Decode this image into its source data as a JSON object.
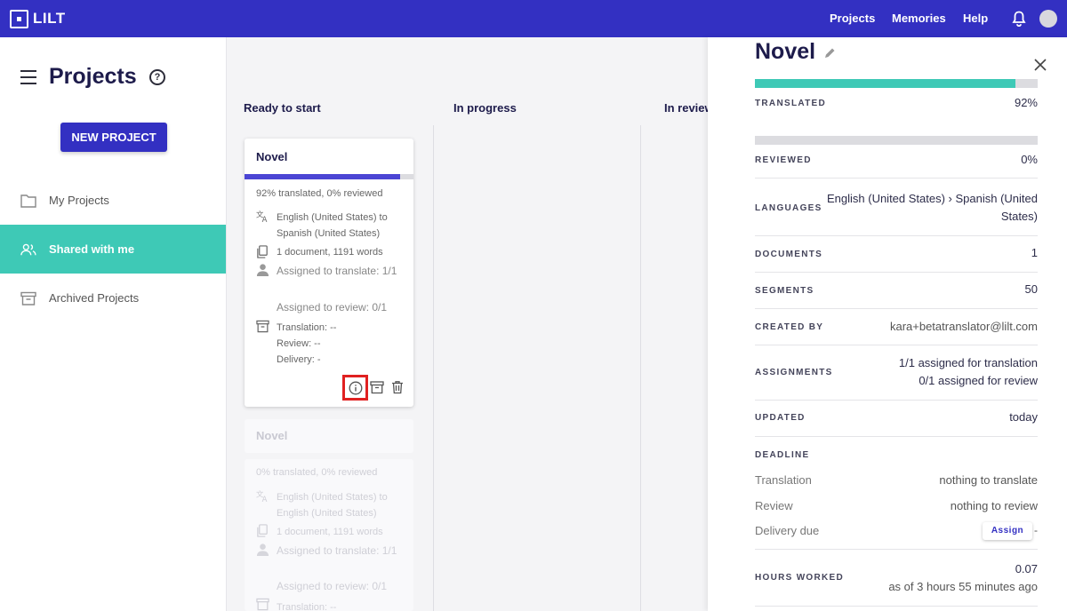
{
  "header": {
    "logo_text": "LILT",
    "nav": [
      "Projects",
      "Memories",
      "Help"
    ]
  },
  "sidebar": {
    "title": "Projects",
    "new_project_label": "NEW PROJECT",
    "items": [
      {
        "label": "My Projects",
        "icon": "folder-icon",
        "active": false
      },
      {
        "label": "Shared with me",
        "icon": "users-icon",
        "active": true
      },
      {
        "label": "Archived Projects",
        "icon": "archive-icon",
        "active": false
      }
    ]
  },
  "board": {
    "columns": [
      "Ready to start",
      "In progress",
      "In review"
    ]
  },
  "card": {
    "title": "Novel",
    "progress_percent": 92,
    "summary": "92% translated, 0% reviewed",
    "languages": "English (United States) to Spanish (United States)",
    "documents": "1 document, 1191 words",
    "assigned_translate": "Assigned to translate: 1/1",
    "assigned_review": "Assigned to review: 0/1",
    "translation": "Translation: --",
    "review": "Review: --",
    "delivery": "Delivery: -"
  },
  "ghost_card": {
    "title": "Novel",
    "summary": "0% translated, 0% reviewed",
    "languages": "English (United States) to English (United States)",
    "documents": "1 document, 1191 words",
    "assigned_translate": "Assigned to translate: 1/1",
    "assigned_review": "Assigned to review: 0/1",
    "translation": "Translation: --"
  },
  "panel": {
    "title": "Novel",
    "translated_percent": 92,
    "reviewed_percent": 0,
    "rows": {
      "translated_label": "TRANSLATED",
      "translated_value": "92%",
      "reviewed_label": "REVIEWED",
      "reviewed_value": "0%",
      "languages_label": "LANGUAGES",
      "languages_value": "English (United States) › Spanish (United States)",
      "documents_label": "DOCUMENTS",
      "documents_value": "1",
      "segments_label": "SEGMENTS",
      "segments_value": "50",
      "created_label": "CREATED BY",
      "created_value": "kara+betatranslator@lilt.com",
      "assignments_label": "ASSIGNMENTS",
      "assignments_translation": "1/1 assigned for translation",
      "assignments_review": "0/1 assigned for review",
      "updated_label": "UPDATED",
      "updated_value": "today",
      "deadline_label": "DEADLINE",
      "deadline_translation_label": "Translation",
      "deadline_translation_value": "nothing to translate",
      "deadline_review_label": "Review",
      "deadline_review_value": "nothing to review",
      "delivery_label": "Delivery due",
      "assign_label": "Assign",
      "delivery_value": "-",
      "hours_label": "HOURS WORKED",
      "hours_value": "0.07",
      "hours_note": "as of 3 hours 55 minutes ago"
    }
  },
  "colors": {
    "brand": "#3330c2",
    "teal": "#3ec9b6",
    "highlight": "#e02020"
  }
}
